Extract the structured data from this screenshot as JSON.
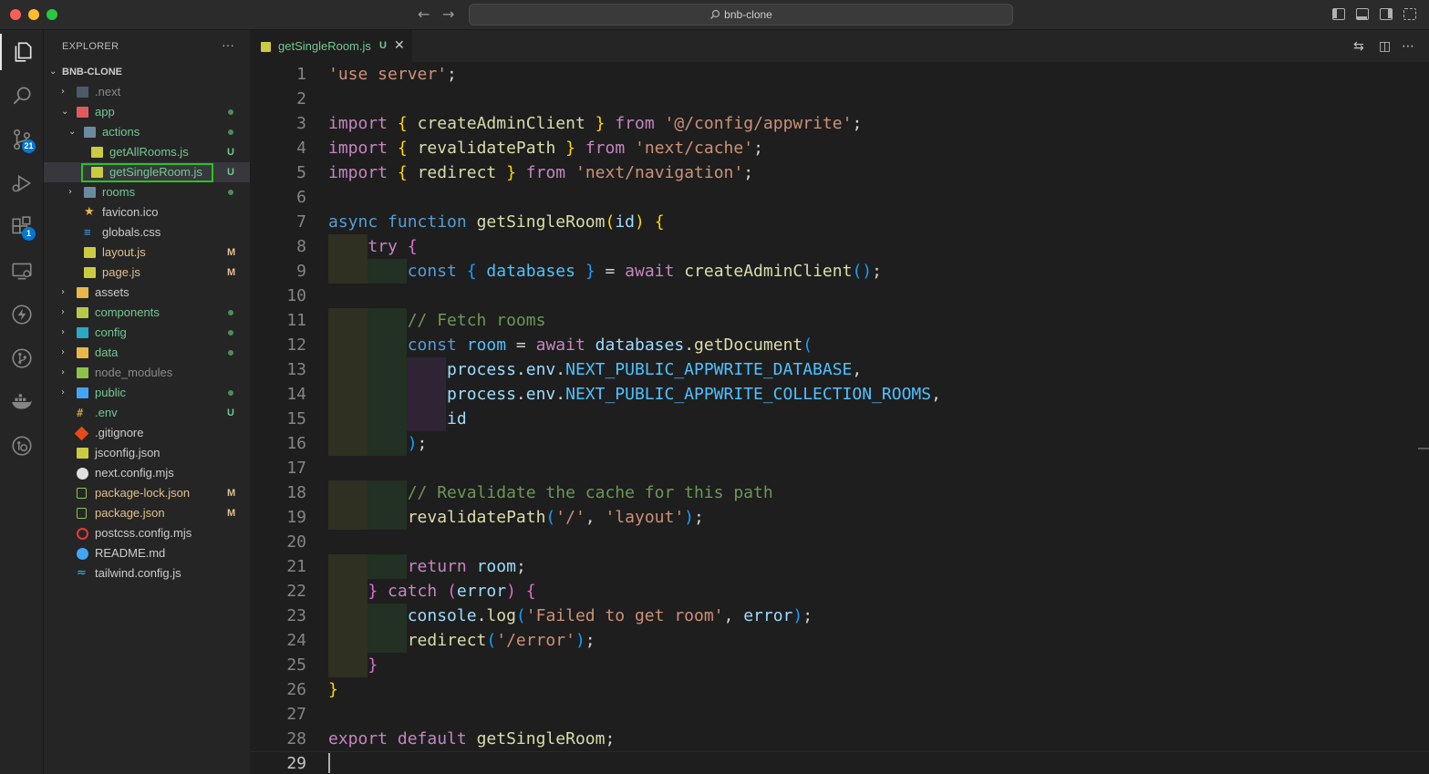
{
  "titlebar": {
    "search_text": "bnb-clone",
    "back_glyph": "←",
    "forward_glyph": "→"
  },
  "activity_bar": {
    "items": [
      {
        "icon": "files-icon"
      },
      {
        "icon": "search-icon"
      },
      {
        "icon": "source-control-icon",
        "badge": "21"
      },
      {
        "icon": "run-debug-icon"
      },
      {
        "icon": "extensions-icon",
        "badge": "1"
      },
      {
        "icon": "remote-explorer-icon"
      },
      {
        "icon": "lightning-icon"
      },
      {
        "icon": "git-graph-icon"
      },
      {
        "icon": "docker-icon"
      },
      {
        "icon": "gitlens-icon"
      }
    ]
  },
  "sidebar": {
    "title": "EXPLORER",
    "more": "···",
    "root": "BNB-CLONE",
    "items": [
      {
        "label": ".next",
        "status": ""
      },
      {
        "label": "app",
        "status": "dot"
      },
      {
        "label": "actions",
        "status": "dot"
      },
      {
        "label": "getAllRooms.js",
        "status": "U"
      },
      {
        "label": "getSingleRoom.js",
        "status": "U"
      },
      {
        "label": "rooms",
        "status": "dot"
      },
      {
        "label": "favicon.ico",
        "status": ""
      },
      {
        "label": "globals.css",
        "status": ""
      },
      {
        "label": "layout.js",
        "status": "M"
      },
      {
        "label": "page.js",
        "status": "M"
      },
      {
        "label": "assets",
        "status": ""
      },
      {
        "label": "components",
        "status": "dot"
      },
      {
        "label": "config",
        "status": "dot"
      },
      {
        "label": "data",
        "status": "dot"
      },
      {
        "label": "node_modules",
        "status": ""
      },
      {
        "label": "public",
        "status": "dot"
      },
      {
        "label": ".env",
        "status": "U"
      },
      {
        "label": ".gitignore",
        "status": ""
      },
      {
        "label": "jsconfig.json",
        "status": ""
      },
      {
        "label": "next.config.mjs",
        "status": ""
      },
      {
        "label": "package-lock.json",
        "status": "M"
      },
      {
        "label": "package.json",
        "status": "M"
      },
      {
        "label": "postcss.config.mjs",
        "status": ""
      },
      {
        "label": "README.md",
        "status": ""
      },
      {
        "label": "tailwind.config.js",
        "status": ""
      }
    ]
  },
  "tab": {
    "label": "getSingleRoom.js",
    "status": "U",
    "close": "✕"
  },
  "editor": {
    "line_numbers": [
      "1",
      "2",
      "3",
      "4",
      "5",
      "6",
      "7",
      "8",
      "9",
      "10",
      "11",
      "12",
      "13",
      "14",
      "15",
      "16",
      "17",
      "18",
      "19",
      "20",
      "21",
      "22",
      "23",
      "24",
      "25",
      "26",
      "27",
      "28",
      "29"
    ],
    "lines": [
      [
        [
          "str",
          "'use server'"
        ],
        [
          "pl",
          ";"
        ]
      ],
      [],
      [
        [
          "ctl",
          "import"
        ],
        [
          "pl",
          " "
        ],
        [
          "br1",
          "{"
        ],
        [
          "pl",
          " "
        ],
        [
          "fn",
          "createAdminClient"
        ],
        [
          "pl",
          " "
        ],
        [
          "br1",
          "}"
        ],
        [
          "pl",
          " "
        ],
        [
          "ctl",
          "from"
        ],
        [
          "pl",
          " "
        ],
        [
          "str",
          "'@/config/appwrite'"
        ],
        [
          "pl",
          ";"
        ]
      ],
      [
        [
          "ctl",
          "import"
        ],
        [
          "pl",
          " "
        ],
        [
          "br1",
          "{"
        ],
        [
          "pl",
          " "
        ],
        [
          "fn",
          "revalidatePath"
        ],
        [
          "pl",
          " "
        ],
        [
          "br1",
          "}"
        ],
        [
          "pl",
          " "
        ],
        [
          "ctl",
          "from"
        ],
        [
          "pl",
          " "
        ],
        [
          "str",
          "'next/cache'"
        ],
        [
          "pl",
          ";"
        ]
      ],
      [
        [
          "ctl",
          "import"
        ],
        [
          "pl",
          " "
        ],
        [
          "br1",
          "{"
        ],
        [
          "pl",
          " "
        ],
        [
          "fn",
          "redirect"
        ],
        [
          "pl",
          " "
        ],
        [
          "br1",
          "}"
        ],
        [
          "pl",
          " "
        ],
        [
          "ctl",
          "from"
        ],
        [
          "pl",
          " "
        ],
        [
          "str",
          "'next/navigation'"
        ],
        [
          "pl",
          ";"
        ]
      ],
      [],
      [
        [
          "kw",
          "async"
        ],
        [
          "pl",
          " "
        ],
        [
          "kw",
          "function"
        ],
        [
          "pl",
          " "
        ],
        [
          "fn",
          "getSingleRoom"
        ],
        [
          "br1",
          "("
        ],
        [
          "vr",
          "id"
        ],
        [
          "br1",
          ")"
        ],
        [
          "pl",
          " "
        ],
        [
          "br1",
          "{"
        ]
      ],
      [
        [
          "pl",
          "    "
        ],
        [
          "ctl",
          "try"
        ],
        [
          "pl",
          " "
        ],
        [
          "br2",
          "{"
        ]
      ],
      [
        [
          "pl",
          "        "
        ],
        [
          "kw",
          "const"
        ],
        [
          "pl",
          " "
        ],
        [
          "br3",
          "{"
        ],
        [
          "pl",
          " "
        ],
        [
          "cst",
          "databases"
        ],
        [
          "pl",
          " "
        ],
        [
          "br3",
          "}"
        ],
        [
          "pl",
          " = "
        ],
        [
          "ctl",
          "await"
        ],
        [
          "pl",
          " "
        ],
        [
          "fn",
          "createAdminClient"
        ],
        [
          "br3",
          "()"
        ],
        [
          "pl",
          ";"
        ]
      ],
      [],
      [
        [
          "pl",
          "        "
        ],
        [
          "cm",
          "// Fetch rooms"
        ]
      ],
      [
        [
          "pl",
          "        "
        ],
        [
          "kw",
          "const"
        ],
        [
          "pl",
          " "
        ],
        [
          "cst",
          "room"
        ],
        [
          "pl",
          " = "
        ],
        [
          "ctl",
          "await"
        ],
        [
          "pl",
          " "
        ],
        [
          "vr",
          "databases"
        ],
        [
          "pl",
          "."
        ],
        [
          "fn",
          "getDocument"
        ],
        [
          "br3",
          "("
        ]
      ],
      [
        [
          "pl",
          "            "
        ],
        [
          "vr",
          "process"
        ],
        [
          "pl",
          "."
        ],
        [
          "vr",
          "env"
        ],
        [
          "pl",
          "."
        ],
        [
          "cst",
          "NEXT_PUBLIC_APPWRITE_DATABASE"
        ],
        [
          "pl",
          ","
        ]
      ],
      [
        [
          "pl",
          "            "
        ],
        [
          "vr",
          "process"
        ],
        [
          "pl",
          "."
        ],
        [
          "vr",
          "env"
        ],
        [
          "pl",
          "."
        ],
        [
          "cst",
          "NEXT_PUBLIC_APPWRITE_COLLECTION_ROOMS"
        ],
        [
          "pl",
          ","
        ]
      ],
      [
        [
          "pl",
          "            "
        ],
        [
          "vr",
          "id"
        ]
      ],
      [
        [
          "pl",
          "        "
        ],
        [
          "br3",
          ")"
        ],
        [
          "pl",
          ";"
        ]
      ],
      [],
      [
        [
          "pl",
          "        "
        ],
        [
          "cm",
          "// Revalidate the cache for this path"
        ]
      ],
      [
        [
          "pl",
          "        "
        ],
        [
          "fn",
          "revalidatePath"
        ],
        [
          "br3",
          "("
        ],
        [
          "str",
          "'/'"
        ],
        [
          "pl",
          ", "
        ],
        [
          "str",
          "'layout'"
        ],
        [
          "br3",
          ")"
        ],
        [
          "pl",
          ";"
        ]
      ],
      [],
      [
        [
          "pl",
          "        "
        ],
        [
          "ctl",
          "return"
        ],
        [
          "pl",
          " "
        ],
        [
          "vr",
          "room"
        ],
        [
          "pl",
          ";"
        ]
      ],
      [
        [
          "pl",
          "    "
        ],
        [
          "br2",
          "}"
        ],
        [
          "pl",
          " "
        ],
        [
          "ctl",
          "catch"
        ],
        [
          "pl",
          " "
        ],
        [
          "br2",
          "("
        ],
        [
          "vr",
          "error"
        ],
        [
          "br2",
          ")"
        ],
        [
          "pl",
          " "
        ],
        [
          "br2",
          "{"
        ]
      ],
      [
        [
          "pl",
          "        "
        ],
        [
          "vr",
          "console"
        ],
        [
          "pl",
          "."
        ],
        [
          "fn",
          "log"
        ],
        [
          "br3",
          "("
        ],
        [
          "str",
          "'Failed to get room'"
        ],
        [
          "pl",
          ", "
        ],
        [
          "vr",
          "error"
        ],
        [
          "br3",
          ")"
        ],
        [
          "pl",
          ";"
        ]
      ],
      [
        [
          "pl",
          "        "
        ],
        [
          "fn",
          "redirect"
        ],
        [
          "br3",
          "("
        ],
        [
          "str",
          "'/error'"
        ],
        [
          "br3",
          ")"
        ],
        [
          "pl",
          ";"
        ]
      ],
      [
        [
          "pl",
          "    "
        ],
        [
          "br2",
          "}"
        ]
      ],
      [
        [
          "br1",
          "}"
        ]
      ],
      [],
      [
        [
          "ctl",
          "export"
        ],
        [
          "pl",
          " "
        ],
        [
          "ctl",
          "default"
        ],
        [
          "pl",
          " "
        ],
        [
          "fn",
          "getSingleRoom"
        ],
        [
          "pl",
          ";"
        ]
      ],
      []
    ]
  }
}
